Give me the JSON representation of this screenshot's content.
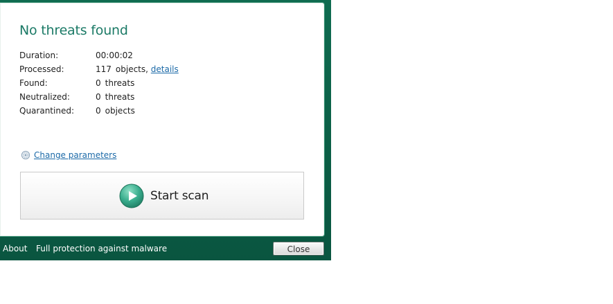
{
  "result": {
    "title": "No threats found"
  },
  "stats": {
    "duration": {
      "label": "Duration:",
      "value": "00:00:02"
    },
    "processed": {
      "label": "Processed:",
      "count": "117",
      "unit": "objects,",
      "link": "details"
    },
    "found": {
      "label": "Found:",
      "count": "0",
      "unit": "threats"
    },
    "neutralized": {
      "label": "Neutralized:",
      "count": "0",
      "unit": "threats"
    },
    "quarantined": {
      "label": "Quarantined:",
      "count": "0",
      "unit": "objects"
    }
  },
  "change_parameters": {
    "label": "Change parameters",
    "icon": "gear-icon"
  },
  "scan": {
    "label": "Start scan",
    "icon": "play-icon"
  },
  "footer": {
    "about": "About",
    "status": "Full protection against malware",
    "close": "Close"
  },
  "colors": {
    "frame": "#0b5e45",
    "title": "#1b7a66",
    "link": "#1c6aa8",
    "play": "#3aae8e"
  }
}
